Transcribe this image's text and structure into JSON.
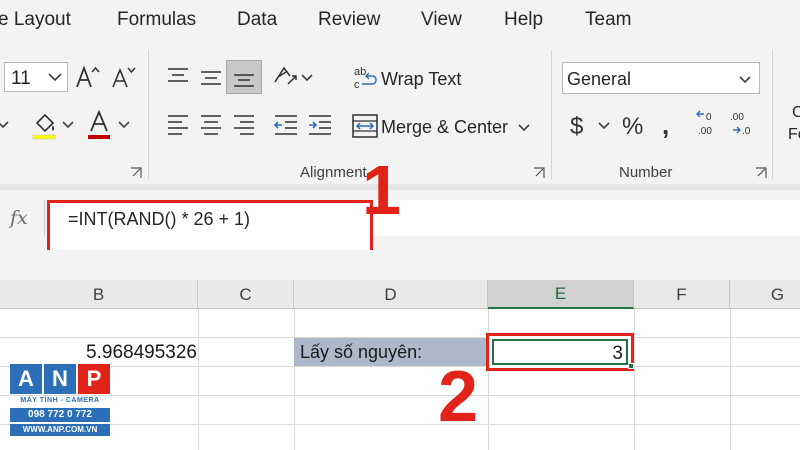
{
  "menu": {
    "items": [
      "e Layout",
      "Formulas",
      "Data",
      "Review",
      "View",
      "Help",
      "Team"
    ]
  },
  "ribbon": {
    "font_size": "11",
    "wrap_text_label": "Wrap Text",
    "merge_center_label": "Merge & Center",
    "number_format": "General",
    "alignment_label": "Alignment",
    "number_label": "Number",
    "cut_off_label_top": "C",
    "cut_off_label_bottom": "Fo"
  },
  "formula_bar": {
    "fx_label": "fx",
    "formula": "=INT(RAND() * 26 + 1)"
  },
  "grid": {
    "columns": [
      "B",
      "C",
      "D",
      "E",
      "F",
      "G"
    ],
    "active_column": "E",
    "cells": {
      "B": "5.968495326",
      "D": "Lấy số nguyên:",
      "E": "3"
    }
  },
  "annotations": [
    "1",
    "2"
  ],
  "logo": {
    "letters": [
      "A",
      "N",
      "P"
    ],
    "letter_colors": [
      "#2a6fb7",
      "#2a6fb7",
      "#e2231a"
    ],
    "tagline": "MÁY TÍNH - CAMERA",
    "phone": "098 772 0 772",
    "website": "WWW.ANP.COM.VN"
  },
  "colors": {
    "accent": "#217346",
    "annotation_red": "#e2231a",
    "selection_fill": "#adb9ca"
  }
}
